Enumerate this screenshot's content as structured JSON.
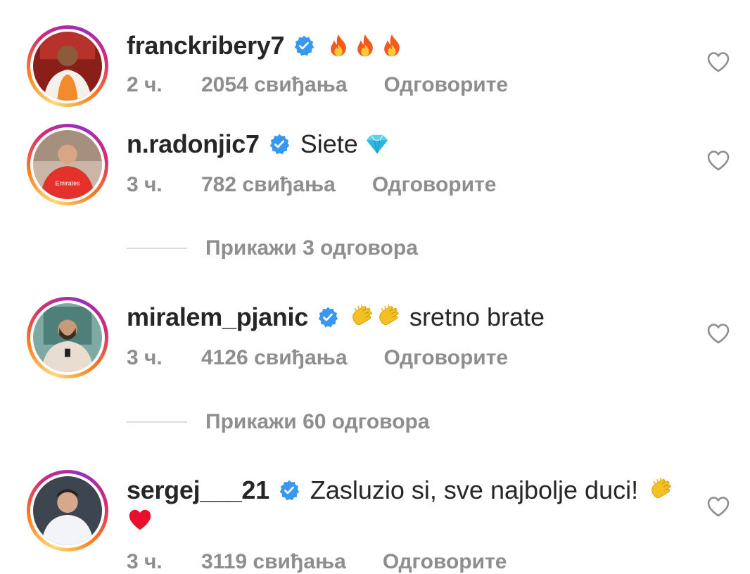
{
  "comments": [
    {
      "username": "franckribery7",
      "text": "",
      "emoji": [
        "fire",
        "fire",
        "fire"
      ],
      "time": "2 ч.",
      "likes": "2054 свиђања",
      "reply": "Одговорите"
    },
    {
      "username": "n.radonjic7",
      "text": "Siete",
      "emoji": [
        "gem"
      ],
      "time": "3 ч.",
      "likes": "782 свиђања",
      "reply": "Одговорите"
    },
    {
      "username": "miralem_pjanic",
      "text": "sretno brate",
      "emoji": [
        "clap",
        "clap"
      ],
      "time": "3 ч.",
      "likes": "4126 свиђања",
      "reply": "Одговорите"
    },
    {
      "username": "sergej___21",
      "text": "Zasluzio si, sve najbolje duci!",
      "emoji": [
        "clap",
        "heart"
      ],
      "time": "3 ч.",
      "likes": "3119 свиђања",
      "reply": "Одговорите"
    }
  ],
  "view_replies": [
    {
      "label": "Прикажи 3 одговора"
    },
    {
      "label": "Прикажи 60 одговора"
    }
  ],
  "colors": {
    "verified": "#3897f0",
    "muted_text": "#8e8e8e",
    "text": "#262626",
    "divider": "#dbdbdb"
  }
}
